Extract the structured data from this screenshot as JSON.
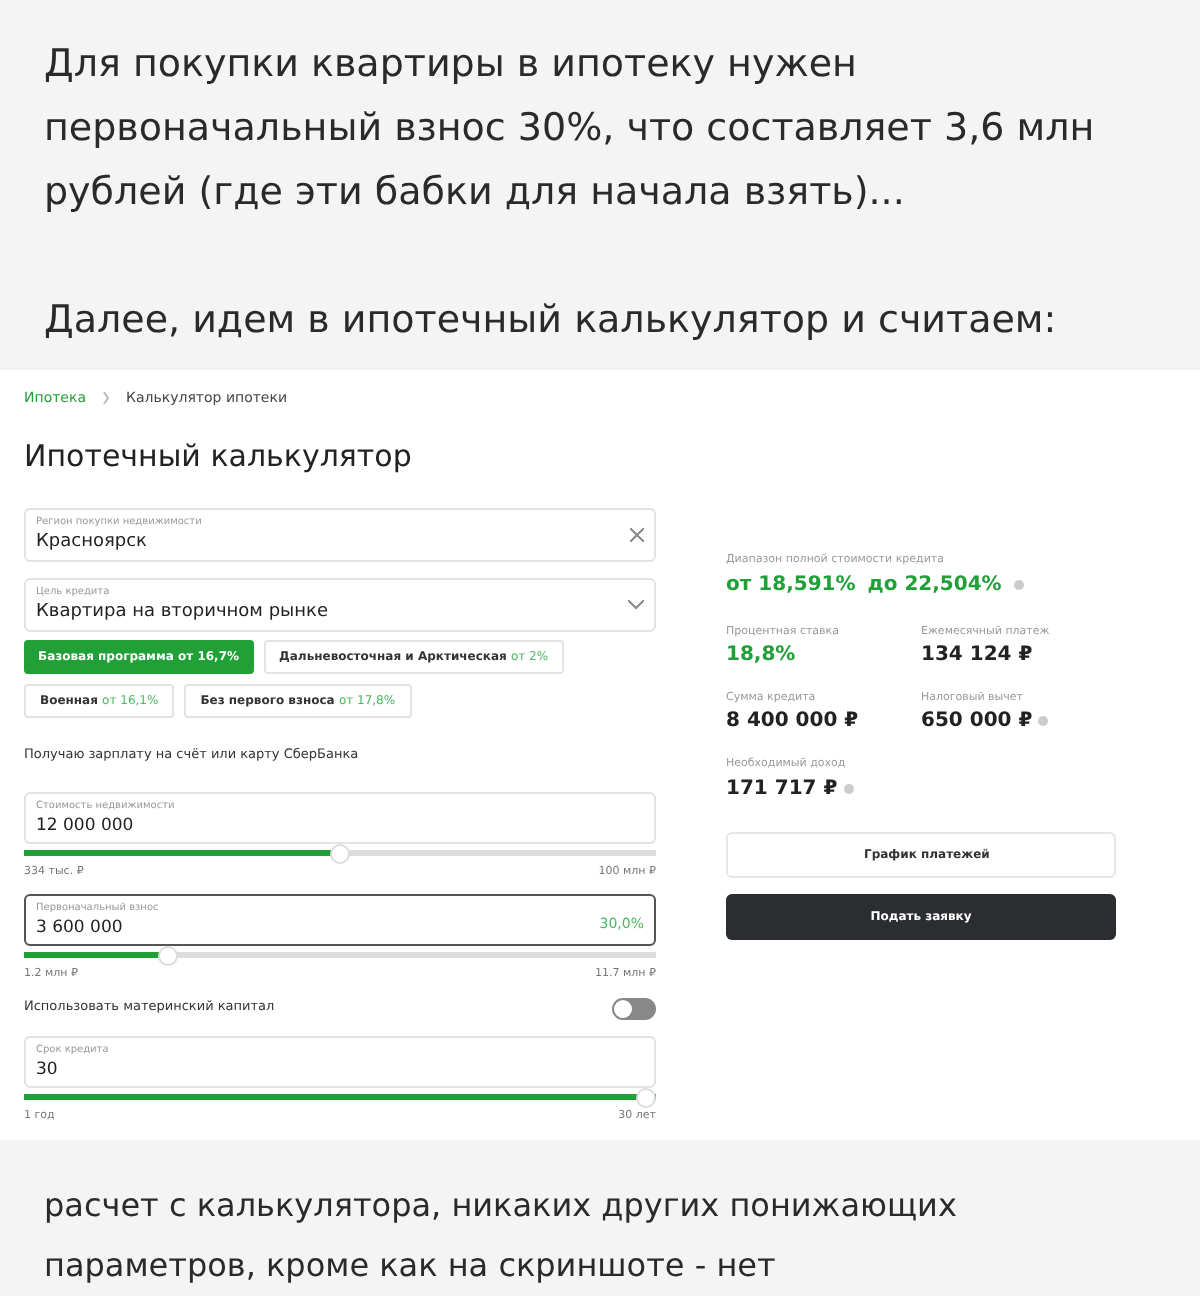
{
  "post_intro": "Для покупки квартиры в ипотеку нужен первоначальный взнос 30%, что составляет 3,6 млн рублей (где эти бабки для начала взять)...",
  "post_lead": "Далее, идем в ипотечный калькулятор и считаем:",
  "calculator": {
    "breadcrumbs": [
      {
        "label": "Ипотека",
        "link": true
      },
      {
        "label": "Калькулятор ипотеки",
        "link": false
      }
    ],
    "title": "Ипотечный калькулятор",
    "region": {
      "label": "Регион покупки недвижимости",
      "value": "Красноярск"
    },
    "goal": {
      "label": "Цель кредита",
      "value": "Квартира на вторичном рынке"
    },
    "programs": [
      {
        "name": "Базовая программа",
        "rate": "от 16,7%",
        "selected": true
      },
      {
        "name": "Дальневосточная и Арктическая",
        "rate": "от 2%",
        "selected": false
      },
      {
        "name": "Военная",
        "rate": "от 16,1%",
        "selected": false
      },
      {
        "name": "Без первого взноса",
        "rate": "от 17,8%",
        "selected": false
      }
    ],
    "salary_note": "Получаю зарплату на счёт или карту СберБанка",
    "sliders": [
      {
        "label": "Стоимость недвижимости",
        "value": "12 000 000",
        "focused": false,
        "level": 0.5,
        "min": "334 тыс. ₽",
        "max": "100 млн ₽"
      },
      {
        "label": "Первоначальный взнос",
        "value": "3 600 000",
        "share": "30,0%",
        "focused": true,
        "level": 0.22,
        "min": "1.2 млн ₽",
        "max": "11.7 млн ₽"
      }
    ],
    "maternity": {
      "label": "Использовать материнский капитал",
      "on": false
    },
    "term": {
      "label": "Срок кредита",
      "value": "30",
      "focused": false,
      "level": 1.0,
      "min": "1 год",
      "max": "30 лет"
    },
    "results": {
      "range_label": "Диапазон полной стоимости кредита",
      "range_from": "от 18,591%",
      "range_to": "до 22,504%",
      "items": [
        {
          "label": "Процентная ставка",
          "value": "18,8%",
          "accent": true,
          "info": false
        },
        {
          "label": "Ежемесячный платеж",
          "value": "134 124 ₽",
          "accent": false,
          "info": false
        },
        {
          "label": "Сумма кредита",
          "value": "8 400 000 ₽",
          "accent": false,
          "info": false
        },
        {
          "label": "Налоговый вычет",
          "value": "650 000 ₽",
          "accent": false,
          "info": true
        },
        {
          "label": "Необходимый доход",
          "value": "171 717 ₽",
          "accent": false,
          "info": true
        }
      ]
    },
    "buttons": [
      {
        "label": "График платежей",
        "kind": "secondary"
      },
      {
        "label": "Подать заявку",
        "kind": "primary"
      }
    ]
  },
  "post_outro": "расчет с калькулятора, никаких других понижающих параметров, кроме как на скриншоте - нет"
}
